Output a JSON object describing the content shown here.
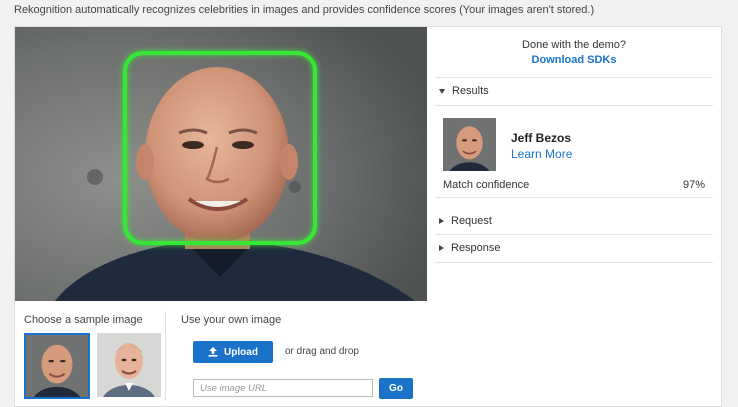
{
  "header": {
    "subtitle": "Rekognition automatically recognizes celebrities in images and provides confidence scores (Your images aren't stored.)"
  },
  "sidebar": {
    "done_text": "Done with the demo?",
    "download_link": "Download SDKs"
  },
  "results": {
    "section_label": "Results",
    "celebrity_name": "Jeff Bezos",
    "learn_more": "Learn More",
    "match_label": "Match confidence",
    "match_value": "97%"
  },
  "request": {
    "label": "Request"
  },
  "response": {
    "label": "Response"
  },
  "samples": {
    "label": "Choose a sample image"
  },
  "upload": {
    "label": "Use your own image",
    "button_label": "Upload",
    "drag_text": "or drag and drop",
    "url_placeholder": "Use image URL",
    "go_label": "Go"
  },
  "colors": {
    "accent": "#1a73c8",
    "face_box": "#39e636"
  }
}
